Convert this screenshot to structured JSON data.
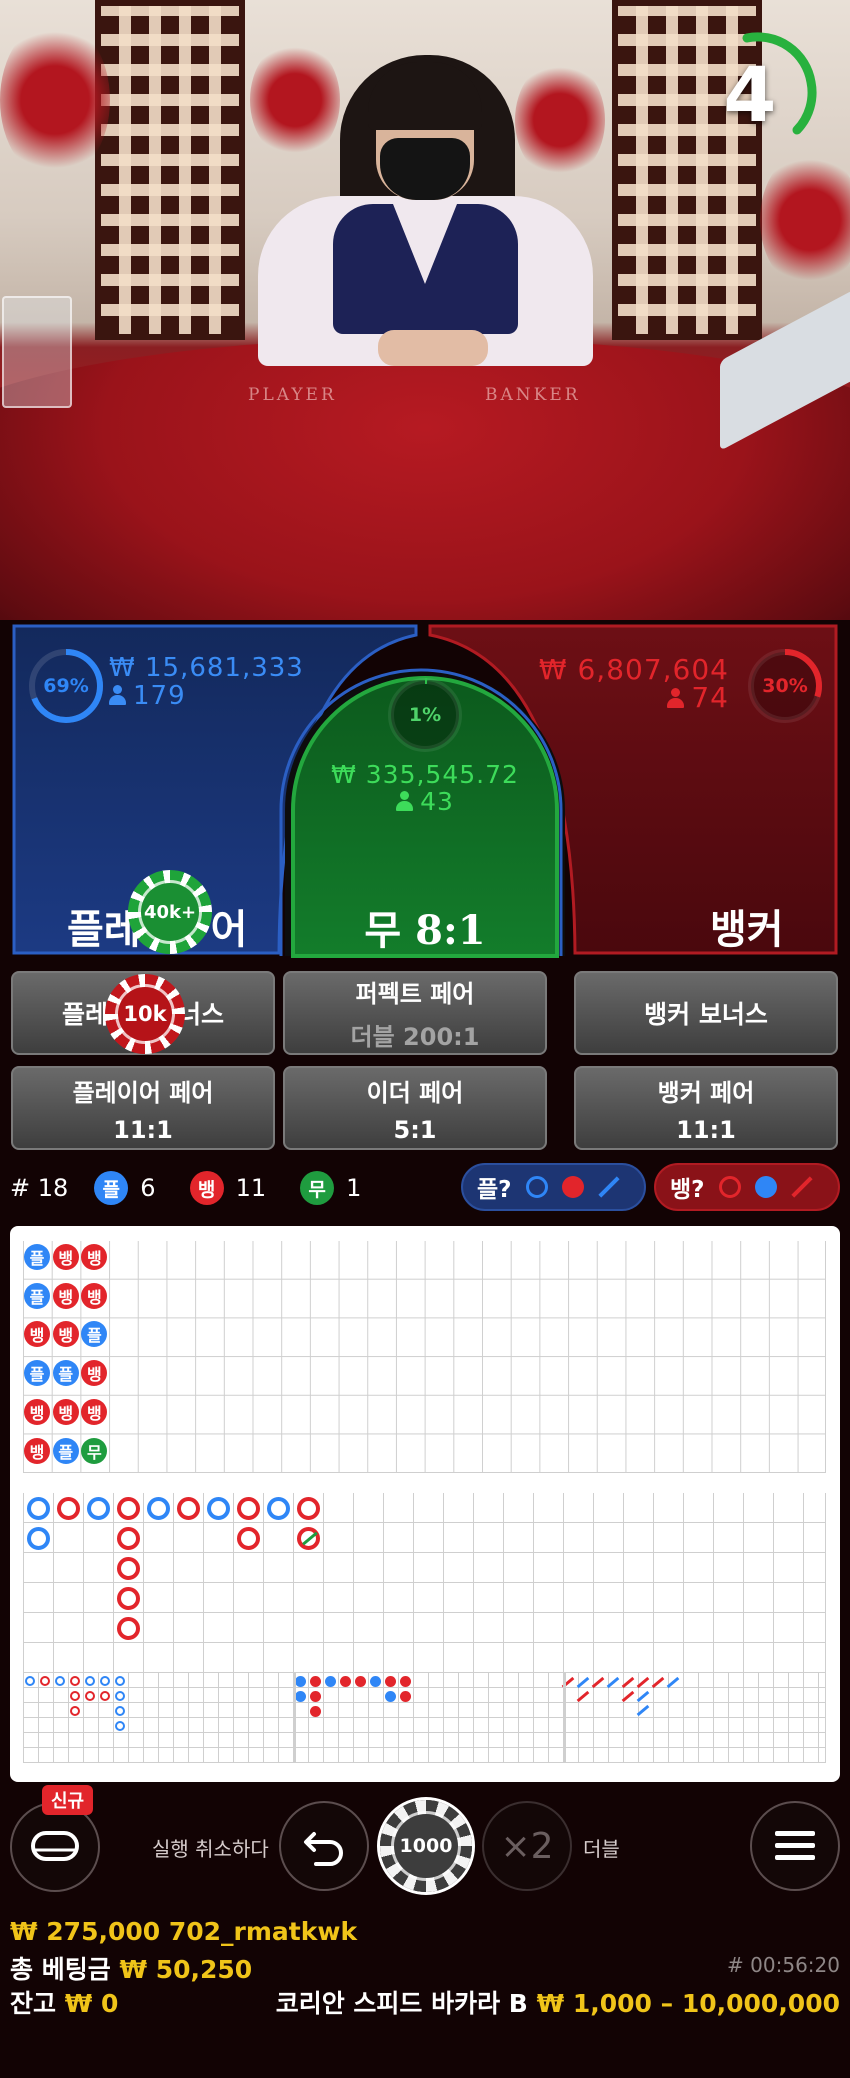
{
  "timer": {
    "value": "4"
  },
  "video": {
    "felt_left": "PLAYER",
    "felt_right": "BANKER"
  },
  "player": {
    "label": "플레이어",
    "label_visible": "플레",
    "label_tail": "어",
    "percent": "69%",
    "percent_value": 69,
    "amount": "₩ 15,681,333",
    "count": "179",
    "chip": "40k+"
  },
  "tie": {
    "label": "무 8:1",
    "percent": "1%",
    "percent_value": 1,
    "amount": "₩ 335,545.72",
    "count": "43"
  },
  "banker": {
    "label": "뱅커",
    "percent": "30%",
    "percent_value": 30,
    "amount": "₩ 6,807,604",
    "count": "74"
  },
  "side_bets": {
    "player_bonus": {
      "label_left": "플레",
      "label_right": "너스",
      "chip": "10k"
    },
    "perfect_pair": {
      "label": "퍼펙트 페어",
      "odds": "더블 200:1"
    },
    "banker_bonus": {
      "label": "뱅커 보너스"
    },
    "player_pair": {
      "label": "플레이어 페어",
      "odds": "11:1"
    },
    "either_pair": {
      "label": "이더 페어",
      "odds": "5:1"
    },
    "banker_pair": {
      "label": "뱅커 페어",
      "odds": "11:1"
    }
  },
  "stats": {
    "round": "# 18",
    "player_tag": "플",
    "player_count": "6",
    "banker_tag": "뱅",
    "banker_count": "11",
    "tie_tag": "무",
    "tie_count": "1"
  },
  "ask": {
    "player": "플?",
    "banker": "뱅?"
  },
  "bead_road": [
    [
      "플",
      "플",
      "뱅",
      "플",
      "뱅",
      "뱅"
    ],
    [
      "뱅",
      "뱅",
      "뱅",
      "플",
      "뱅",
      "플"
    ],
    [
      "뱅",
      "뱅",
      "플",
      "뱅",
      "뱅",
      "무"
    ]
  ],
  "controls": {
    "new_badge": "신규",
    "undo_label": "실행 취소하다",
    "chip_value": "1000",
    "double_symbol": "×2",
    "double_label": "더블"
  },
  "footer": {
    "balance_user": "₩ 275,000 702_rmatkwk",
    "total_bet_label": "총 베팅금",
    "total_bet": "₩ 50,250",
    "remaining_label": "잔고",
    "remaining": "₩ 0",
    "game_id": "# 00:56:20",
    "table_name": "코리안 스피드 바카라 B",
    "limits": "₩ 1,000 – 10,000,000"
  },
  "colors": {
    "player": "#2f86f6",
    "banker": "#e2252b",
    "tie": "#1f9c3f",
    "gold": "#f0c419"
  }
}
